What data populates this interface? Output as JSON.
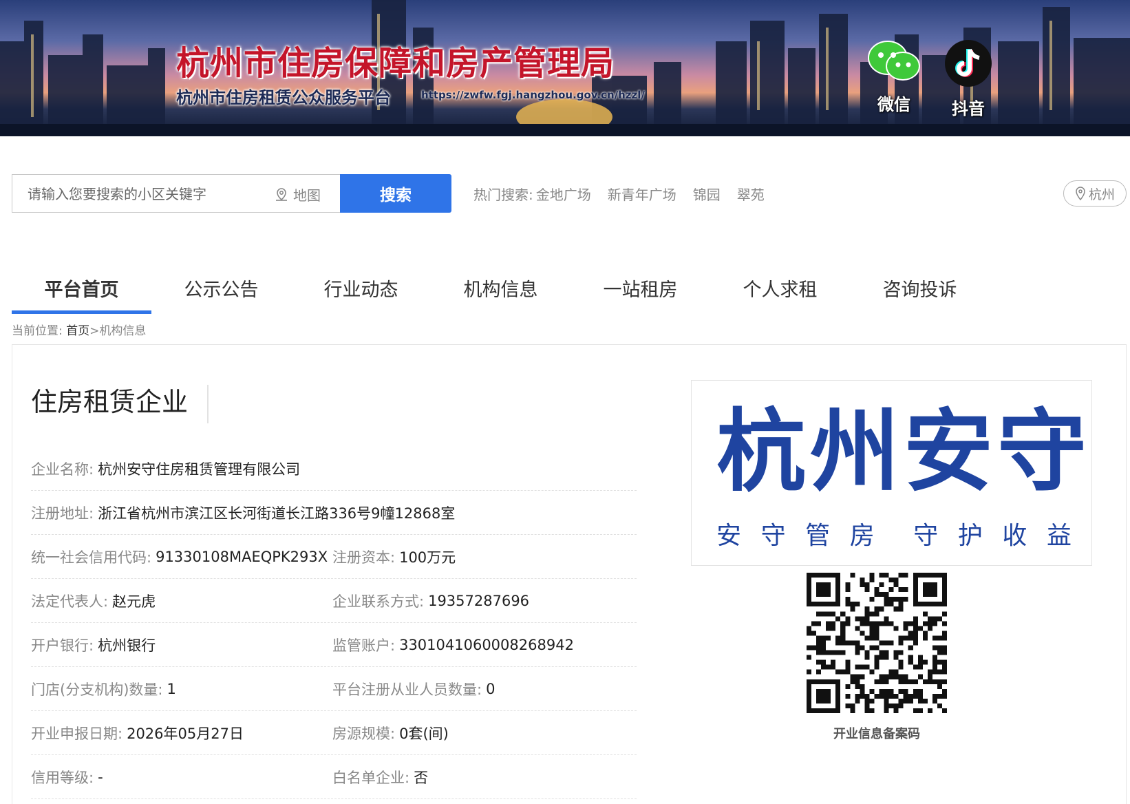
{
  "banner": {
    "title": "杭州市住房保障和房产管理局",
    "subtitle": "杭州市住房租赁公众服务平台",
    "url": "https://zwfw.fgj.hangzhou.gov.cn/hzzl/",
    "social": [
      {
        "label": "微信",
        "icon": "wechat-icon"
      },
      {
        "label": "抖音",
        "icon": "douyin-icon"
      }
    ]
  },
  "search": {
    "placeholder": "请输入您要搜索的小区关键字",
    "map_label": "地图",
    "button_label": "搜索",
    "hot_label": "热门搜索:",
    "hot_keywords": [
      "金地广场",
      "新青年广场",
      "锦园",
      "翠苑"
    ],
    "city": "杭州"
  },
  "nav": {
    "tabs": [
      "平台首页",
      "公示公告",
      "行业动态",
      "机构信息",
      "一站租房",
      "个人求租",
      "咨询投诉"
    ],
    "active": "平台首页"
  },
  "breadcrumb": {
    "prefix": "当前位置:",
    "home": "首页",
    "separator": ">",
    "current": "机构信息"
  },
  "company": {
    "section_title": "住房租赁企业",
    "name_label": "企业名称:",
    "name": "杭州安守住房租赁管理有限公司",
    "address_label": "注册地址:",
    "address": "浙江省杭州市滨江区长河街道长江路336号9幢12868室",
    "credit_code_label": "统一社会信用代码:",
    "credit_code": "91330108MAEQPK293X",
    "capital_label": "注册资本:",
    "capital": "100万元",
    "legal_rep_label": "法定代表人:",
    "legal_rep": "赵元虎",
    "contact_label": "企业联系方式:",
    "contact": "19357287696",
    "bank_label": "开户银行:",
    "bank": "杭州银行",
    "account_label": "监管账户:",
    "account": "3301041060008268942",
    "branches_label": "门店(分支机构)数量:",
    "branches": "1",
    "staff_label": "平台注册从业人员数量:",
    "staff": "0",
    "open_date_label": "开业申报日期:",
    "open_date": "2026年05月27日",
    "scale_label": "房源规模:",
    "scale": "0套(间)",
    "credit_level_label": "信用等级:",
    "credit_level": "-",
    "whitelist_label": "白名单企业:",
    "whitelist": "否"
  },
  "logo": {
    "main": "杭州安守",
    "slogan": [
      "安",
      "守",
      "管",
      "房",
      "守",
      "护",
      "收",
      "益"
    ],
    "color": "#1f44a0"
  },
  "qr": {
    "caption": "开业信息备案码"
  },
  "colors": {
    "accent": "#2f74e8",
    "title_red": "#c4152a"
  }
}
